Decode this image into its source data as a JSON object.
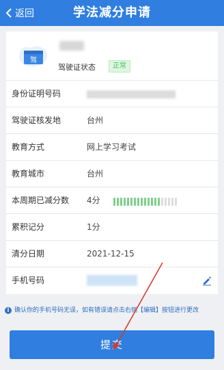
{
  "header": {
    "back_label": "返回",
    "title": "学法减分申请"
  },
  "profile": {
    "avatar_text": "驾",
    "status_label": "驾驶证状态",
    "status_badge": "正常"
  },
  "rows": [
    {
      "label": "身份证明号码",
      "value": ""
    },
    {
      "label": "驾驶证核发地",
      "value": "台州"
    },
    {
      "label": "教育方式",
      "value": "网上学习考试"
    },
    {
      "label": "教育城市",
      "value": "台州"
    },
    {
      "label": "本周期已减分数",
      "value": "4分"
    },
    {
      "label": "累积记分",
      "value": "1分"
    },
    {
      "label": "清分日期",
      "value": "2021-12-15"
    },
    {
      "label": "手机号码",
      "value": ""
    }
  ],
  "progress": {
    "filled_segments": 14,
    "total_segments": 19
  },
  "notice": {
    "text": "确认你的手机号码无误，如有错误请点击右侧【编辑】按钮进行更改"
  },
  "submit_label": "提交",
  "colors": {
    "primary": "#2f7ee0",
    "badge_green": "#47c05d",
    "annotation_arrow": "#d93a2b"
  }
}
